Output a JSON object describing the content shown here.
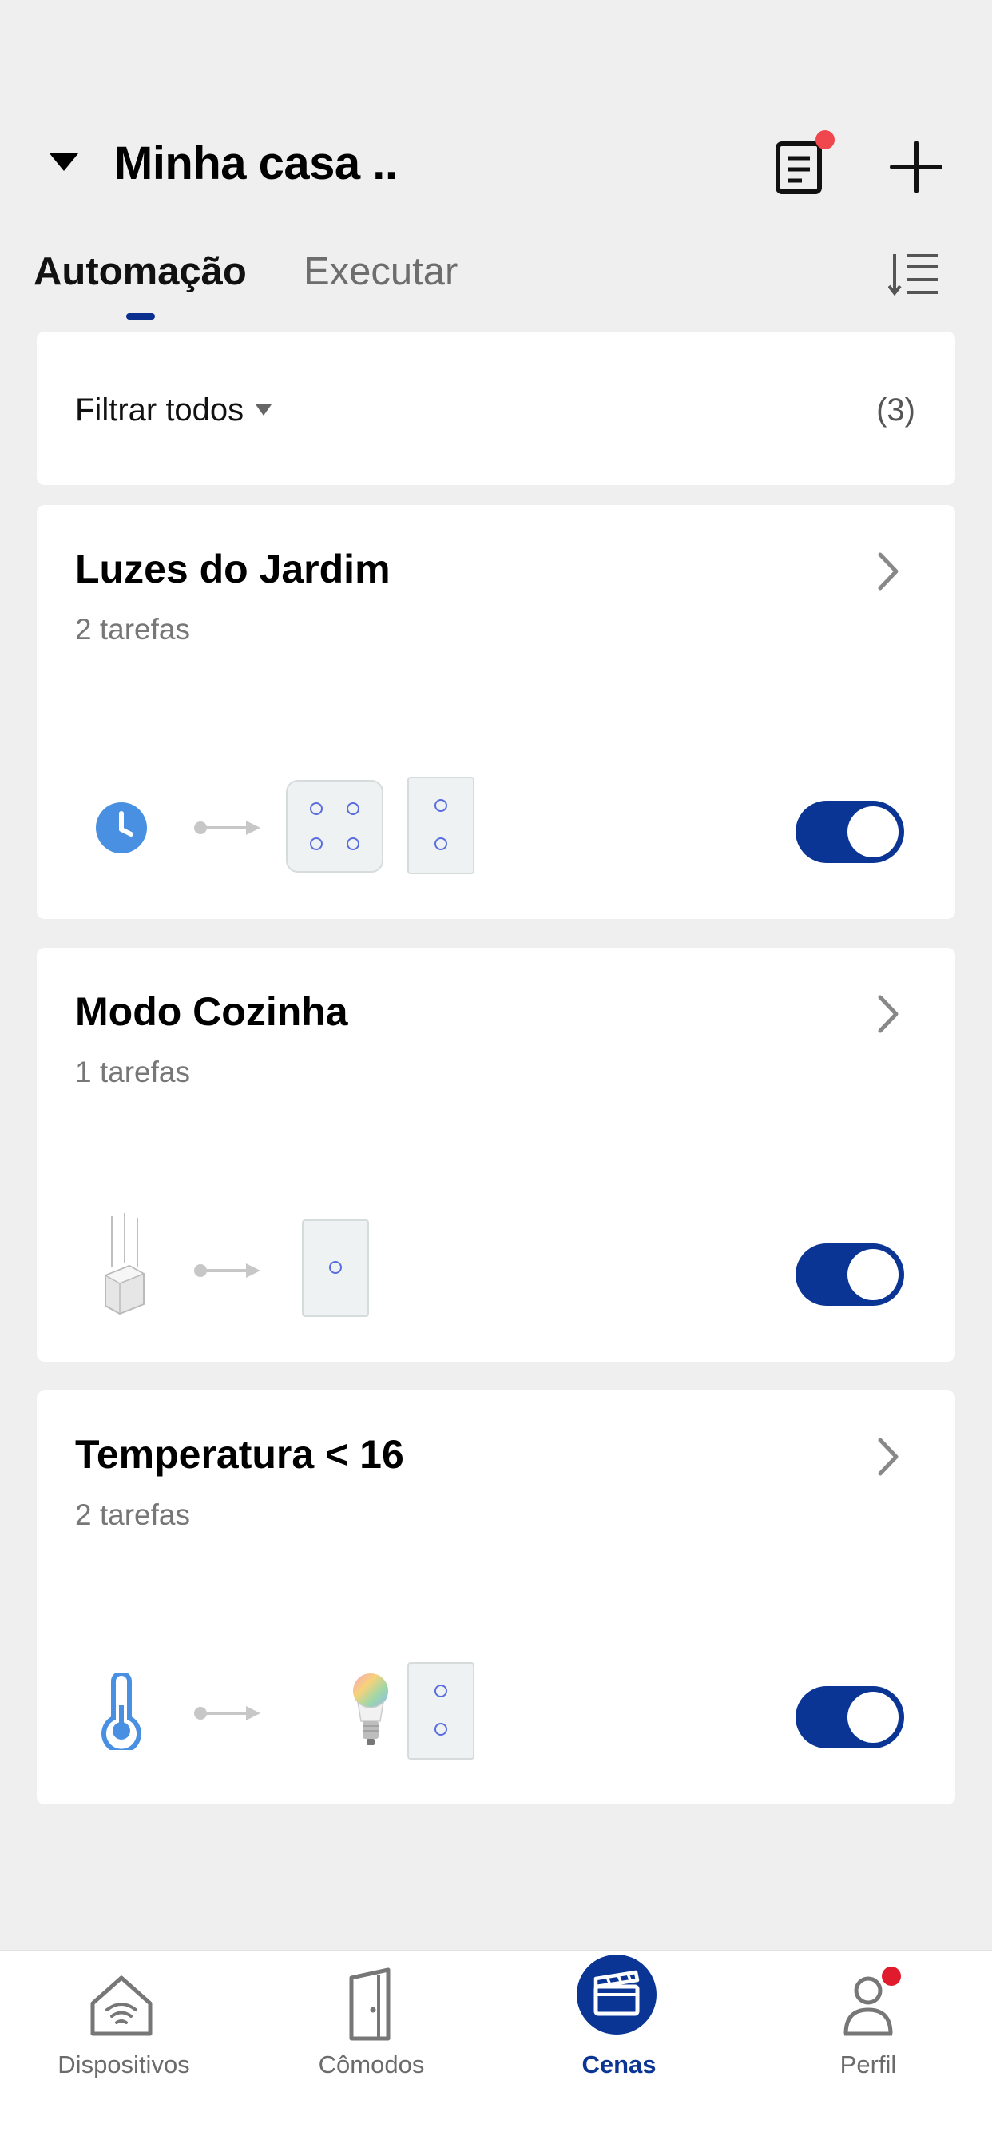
{
  "header": {
    "home_name": "Minha casa ..",
    "notes_has_notification": true
  },
  "tabs": [
    {
      "label": "Automação",
      "active": true
    },
    {
      "label": "Executar",
      "active": false
    }
  ],
  "filter": {
    "label": "Filtrar todos",
    "count": "(3)"
  },
  "automations": [
    {
      "title": "Luzes do Jardim",
      "subtitle": "2 tarefas",
      "condition_icon": "clock-icon",
      "action_icons": [
        "four-gang-switch-icon",
        "two-gang-switch-icon"
      ],
      "enabled": true
    },
    {
      "title": "Modo Cozinha",
      "subtitle": "1 tarefas",
      "condition_icon": "pendant-sensor-icon",
      "action_icons": [
        "one-gang-switch-icon"
      ],
      "enabled": true
    },
    {
      "title": "Temperatura < 16",
      "subtitle": "2 tarefas",
      "condition_icon": "thermometer-icon",
      "action_icons": [
        "smart-bulb-icon",
        "two-gang-switch-icon"
      ],
      "enabled": true
    }
  ],
  "bottom_nav": [
    {
      "label": "Dispositivos",
      "icon": "home-wifi-icon",
      "active": false
    },
    {
      "label": "Cômodos",
      "icon": "door-icon",
      "active": false
    },
    {
      "label": "Cenas",
      "icon": "clapperboard-icon",
      "active": true
    },
    {
      "label": "Perfil",
      "icon": "user-icon",
      "active": false,
      "has_notification": true
    }
  ],
  "colors": {
    "background": "#efefef",
    "accent": "#0a3594",
    "toggle_on": "#0a3594",
    "notification": "#f0474e",
    "icon_blue": "#4a90e2"
  }
}
